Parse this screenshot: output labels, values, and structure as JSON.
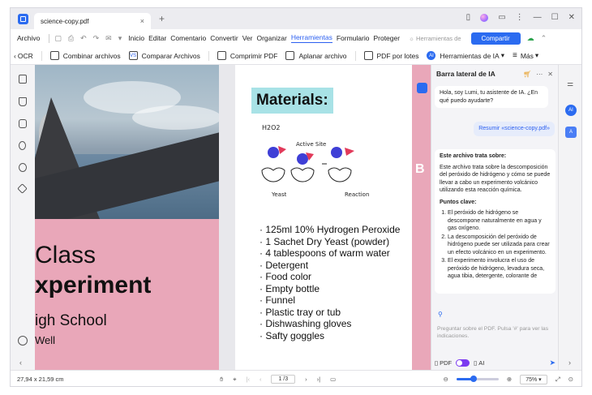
{
  "window": {
    "tab_title": "science-copy.pdf",
    "tab_close": "×",
    "new_tab": "+",
    "controls": [
      "▢",
      "⚇",
      "☰",
      "⋮",
      "—",
      "▢",
      "✕"
    ]
  },
  "menu": {
    "items": [
      "Archivo",
      "Inicio",
      "Editar",
      "Comentario",
      "Convertir",
      "Ver",
      "Organizar",
      "Herramientas",
      "Formulario",
      "Proteger"
    ],
    "active_index": 7,
    "search_placeholder": "Herramientas de",
    "share_label": "Compartir"
  },
  "toolbar": {
    "ocr_label": "OCR",
    "items": [
      {
        "label": "Combinar archivos",
        "icon": "combine-icon"
      },
      {
        "label": "Comparar Archivos",
        "icon": "compare-icon"
      },
      {
        "label": "Comprimir PDF",
        "icon": "compress-icon"
      },
      {
        "label": "Aplanar archivo",
        "icon": "flatten-icon"
      },
      {
        "label": "PDF por lotes",
        "icon": "batch-icon"
      },
      {
        "label": "Herramientas de IA",
        "icon": "ai-icon"
      },
      {
        "label": "Más",
        "icon": "more-icon"
      }
    ]
  },
  "document": {
    "page1": {
      "line1": "Class",
      "line2": "xperiment",
      "line3": "igh School",
      "line4": "Well"
    },
    "page2": {
      "title": "Materials:",
      "diagram_labels": {
        "h2o2": "H2O2",
        "active_site": "Active Site",
        "yeast": "Yeast",
        "reaction": "Reaction"
      },
      "items": [
        "125ml 10% Hydrogen Peroxide",
        "1 Sachet Dry Yeast (powder)",
        "4 tablespoons of warm water",
        "Detergent",
        "Food color",
        "Empty bottle",
        "Funnel",
        "Plastic tray or tub",
        "Dishwashing gloves",
        "Safty goggles"
      ]
    }
  },
  "ai_panel": {
    "title": "Barra lateral de IA",
    "greeting": "Hola, soy Lumi, tu asistente de IA. ¿En qué puedo ayudarte?",
    "user_message": "Resumir «science-copy.pdf»",
    "summary_heading": "Este archivo trata sobre:",
    "summary_body": "Este archivo trata sobre la descomposición del peróxido de hidrógeno y cómo se puede llevar a cabo un experimento volcánico utilizando esta reacción química.",
    "key_points_heading": "Puntos clave:",
    "key_points": [
      "El peróxido de hidrógeno se descompone naturalmente en agua y gas oxígeno.",
      "La descomposición del peróxido de hidrógeno puede ser utilizada para crear un efecto volcánico en un experimento.",
      "El experimento involucra el uso de peróxido de hidrógeno, levadura seca, agua tibia, detergente, colorante de"
    ],
    "input_placeholder": "Preguntar sobre el PDF. Pulsa '#' para ver las indicaciones.",
    "mode_pdf": "PDF",
    "mode_ai": "AI"
  },
  "statusbar": {
    "page_size": "27,94 x 21,59 cm",
    "page_indicator": "1 /3",
    "zoom": "75%",
    "zoom_level": 0.4
  },
  "colors": {
    "accent": "#2b6bf0",
    "page_pink": "#e9a7b9",
    "title_highlight": "#a8e2e6"
  }
}
